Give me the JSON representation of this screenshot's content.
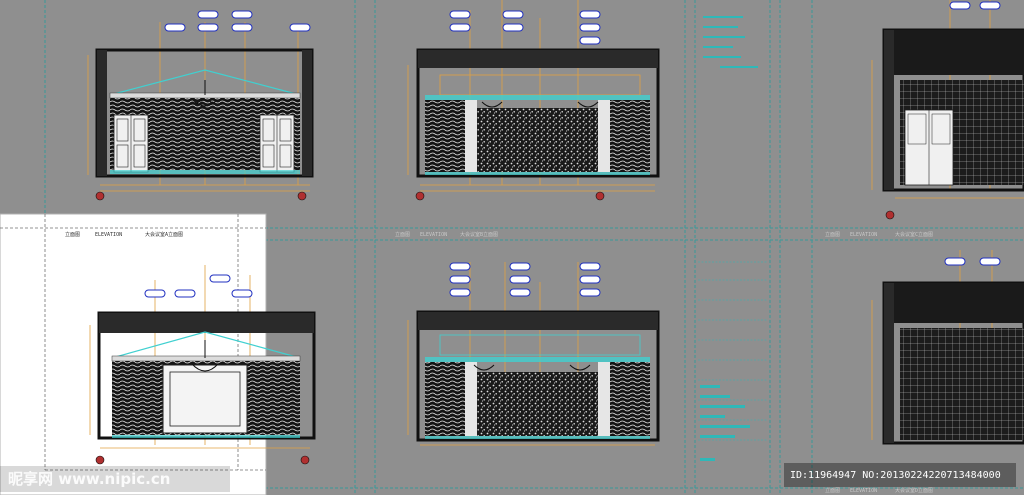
{
  "viewer": {
    "colors": {
      "background": "#8f8f8f",
      "sheet_border": "#3a9a9a",
      "dimension": "#e0a040",
      "callout": "#2030c0",
      "wall": "#101010",
      "cyan": "#40d0d0",
      "page": "#ffffff"
    }
  },
  "watermark": {
    "site": "昵享网 www.nipic.cn",
    "id_text": "ID:11964947 NO:20130224220713484000"
  },
  "sheets": [
    {
      "id": "a",
      "title_left": "立面图",
      "title_mid": "ELEVATION",
      "title_right": "大会议室A立面图"
    },
    {
      "id": "b",
      "title_left": "立面图",
      "title_mid": "ELEVATION",
      "title_right": "大会议室B立面图"
    },
    {
      "id": "c",
      "title_left": "立面图",
      "title_mid": "ELEVATION",
      "title_right": "大会议室C立面图"
    },
    {
      "id": "d",
      "title_left": "立面图",
      "title_mid": "ELEVATION",
      "title_right": "大会议室D立面图"
    }
  ]
}
